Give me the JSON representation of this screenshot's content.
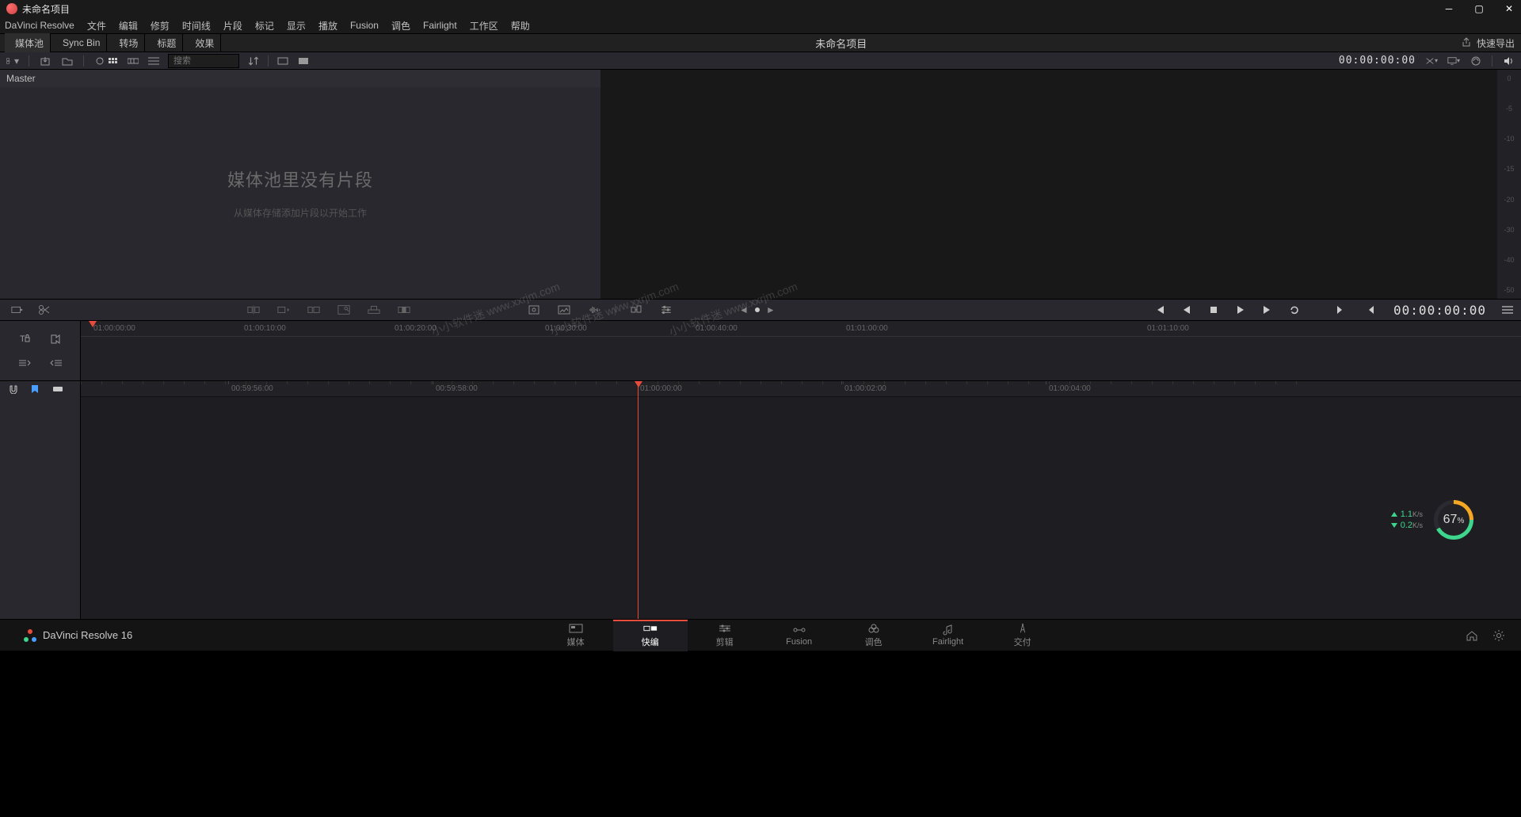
{
  "titlebar": {
    "title": "未命名项目"
  },
  "menubar": {
    "items": [
      "DaVinci Resolve",
      "文件",
      "编辑",
      "修剪",
      "时间线",
      "片段",
      "标记",
      "显示",
      "播放",
      "Fusion",
      "调色",
      "Fairlight",
      "工作区",
      "帮助"
    ]
  },
  "toolbar": {
    "media_pool": "媒体池",
    "sync_bin": "Sync Bin",
    "transition": "转场",
    "title": "标题",
    "effect": "效果",
    "center_title": "未命名项目",
    "quick_export": "快速导出",
    "timecode_right": "00:00:00:00"
  },
  "subtoolbar": {
    "search_placeholder": "搜索"
  },
  "media": {
    "master": "Master",
    "empty_title": "媒体池里没有片段",
    "empty_sub": "从媒体存储添加片段以开始工作"
  },
  "waveform_ticks": [
    "0",
    "-5",
    "-10",
    "-15",
    "-20",
    "-30",
    "-40",
    "-50"
  ],
  "upper_ruler": [
    {
      "label": "01:00:00:00",
      "pos": 16
    },
    {
      "label": "01:00:10:00",
      "pos": 206
    },
    {
      "label": "01:00:20:00",
      "pos": 396
    },
    {
      "label": "01:00:30:00",
      "pos": 586
    },
    {
      "label": "01:00:40:00",
      "pos": 776
    },
    {
      "label": "01:01:00:00",
      "pos": 966
    },
    {
      "label": "01:01:10:00",
      "pos": 1346
    }
  ],
  "lower_ruler": [
    {
      "label": "00:59:56:00",
      "pos": 190
    },
    {
      "label": "00:59:58:00",
      "pos": 448
    },
    {
      "label": "01:00:00:00",
      "pos": 706
    },
    {
      "label": "01:00:02:00",
      "pos": 964
    },
    {
      "label": "01:00:04:00",
      "pos": 1222
    }
  ],
  "mid": {
    "timecode": "00:00:00:00"
  },
  "overlay": {
    "up_val": "1.1",
    "dn_val": "0.2",
    "unit": "K/s",
    "gauge_val": "67",
    "gauge_pct": "%"
  },
  "pages": {
    "items": [
      "媒体",
      "快编",
      "剪辑",
      "Fusion",
      "调色",
      "Fairlight",
      "交付"
    ],
    "brand": "DaVinci Resolve 16"
  },
  "watermark": "小小软件迷 www.xxrjm.com"
}
